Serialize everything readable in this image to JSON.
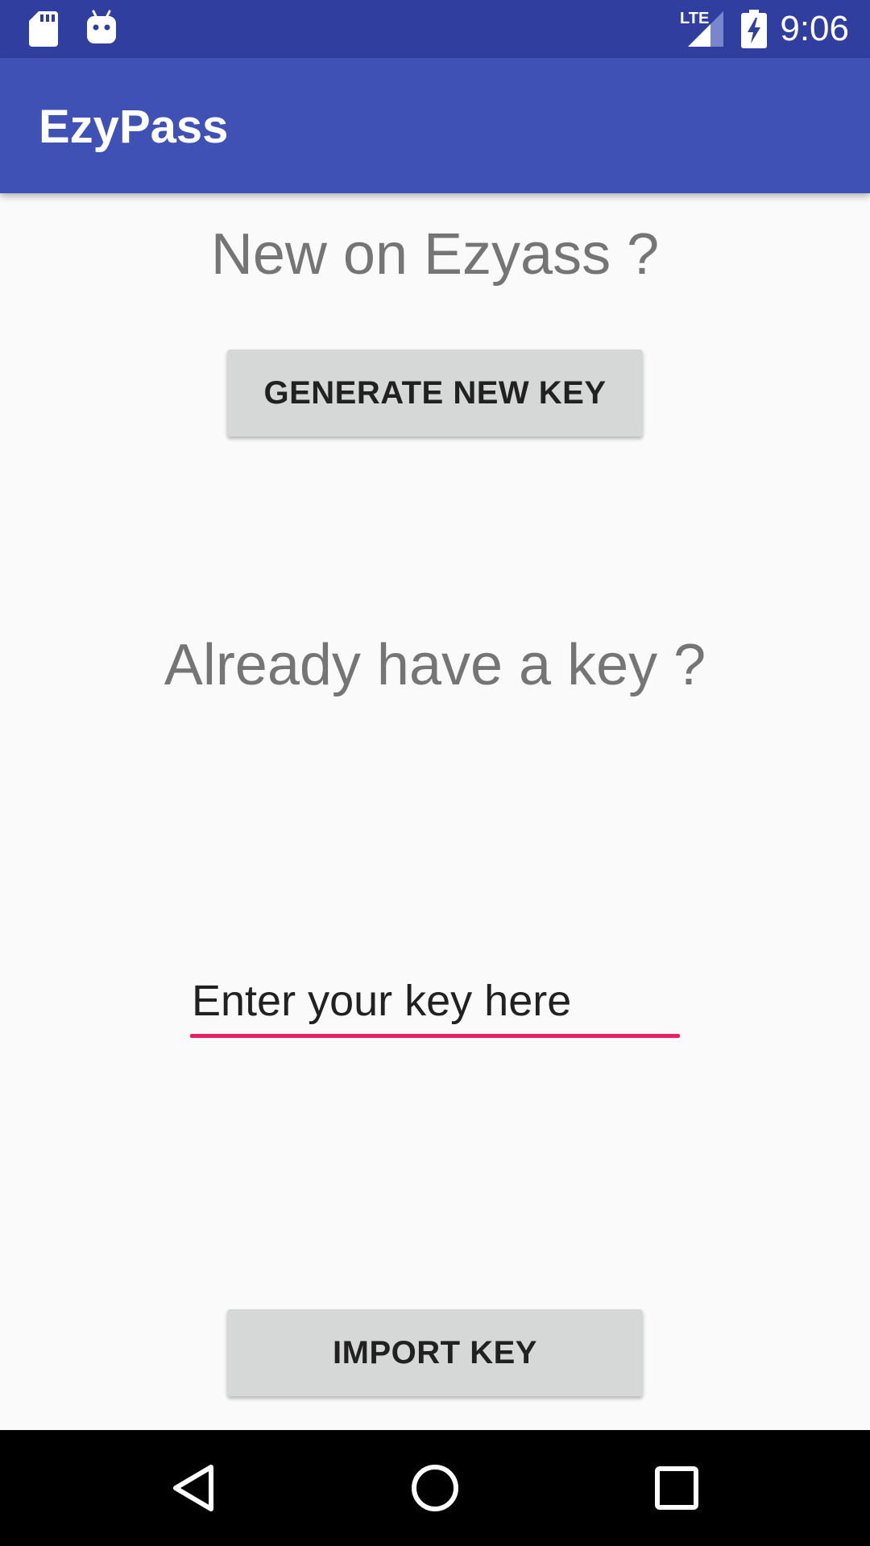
{
  "status_bar": {
    "time": "9:06",
    "network_label": "LTE",
    "icons": [
      "sd-card-icon",
      "android-notification-icon",
      "lte-signal-icon",
      "battery-charging-icon"
    ]
  },
  "app_bar": {
    "title": "EzyPass"
  },
  "main": {
    "new_heading": "New on Ezyass ?",
    "generate_button_label": "GENERATE NEW KEY",
    "existing_heading": "Already have a key ?",
    "key_input": {
      "placeholder": "Enter your key here",
      "value": ""
    },
    "import_button_label": "IMPORT KEY"
  },
  "nav_bar": {
    "icons": [
      "back-icon",
      "home-icon",
      "recents-icon"
    ]
  },
  "colors": {
    "status_bar": "#303f9f",
    "app_bar": "#3f51b5",
    "accent": "#e91e63",
    "button": "#d6d7d7",
    "heading_text": "#757575",
    "background": "#fafafa"
  }
}
